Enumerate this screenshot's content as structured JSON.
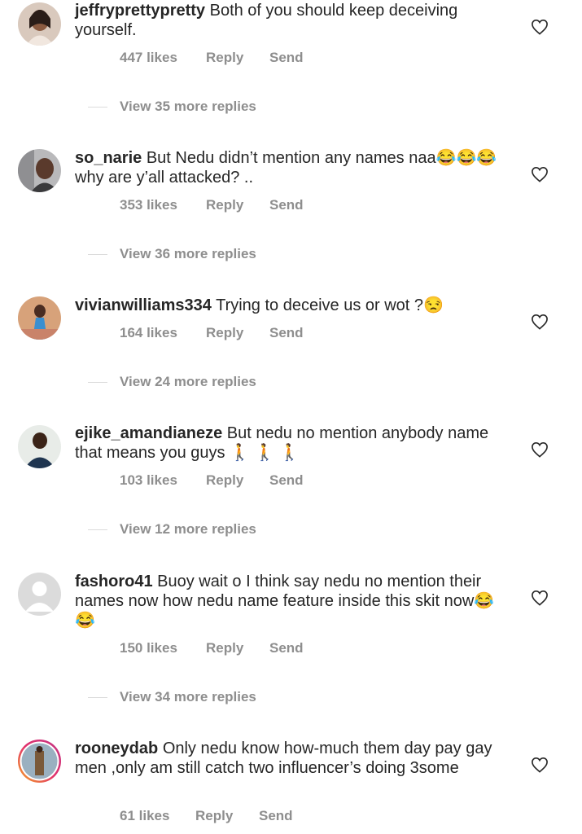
{
  "comments": [
    {
      "username": "jeffryprettypretty",
      "text": "Both of you should keep deceiving yourself.",
      "likes": "447 likes",
      "reply": "Reply",
      "send": "Send",
      "view_replies": "View 35 more replies"
    },
    {
      "username": "so_narie",
      "text": "But Nedu didn’t mention any names naa😂😂😂 why are y’all attacked? ..",
      "likes": "353 likes",
      "reply": "Reply",
      "send": "Send",
      "view_replies": "View 36 more replies"
    },
    {
      "username": "vivianwilliams334",
      "text": "Trying to deceive us or wot ?😒",
      "likes": "164 likes",
      "reply": "Reply",
      "send": "Send",
      "view_replies": "View 24 more replies"
    },
    {
      "username": "ejike_amandianeze",
      "text": "But nedu no mention anybody name that means you guys 🚶 🚶 🚶",
      "likes": "103 likes",
      "reply": "Reply",
      "send": "Send",
      "view_replies": "View 12 more replies"
    },
    {
      "username": "fashoro41",
      "text": "Buoy wait o I think say nedu no mention their names now how nedu name feature inside this skit now😂😂",
      "likes": "150 likes",
      "reply": "Reply",
      "send": "Send",
      "view_replies": "View 34 more replies"
    },
    {
      "username": "rooneydab",
      "text": "Only nedu know how-much them day pay gay men ,only am  still catch two influencer’s doing 3some",
      "likes": "61 likes",
      "reply": "Reply",
      "send": "Send",
      "view_replies": ""
    }
  ],
  "icons": {
    "heart": "heart-outline-icon",
    "avatar": "user-avatar"
  },
  "colors": {
    "text": "#262626",
    "meta": "#8e8e8e",
    "divider": "#dbdbdb"
  }
}
